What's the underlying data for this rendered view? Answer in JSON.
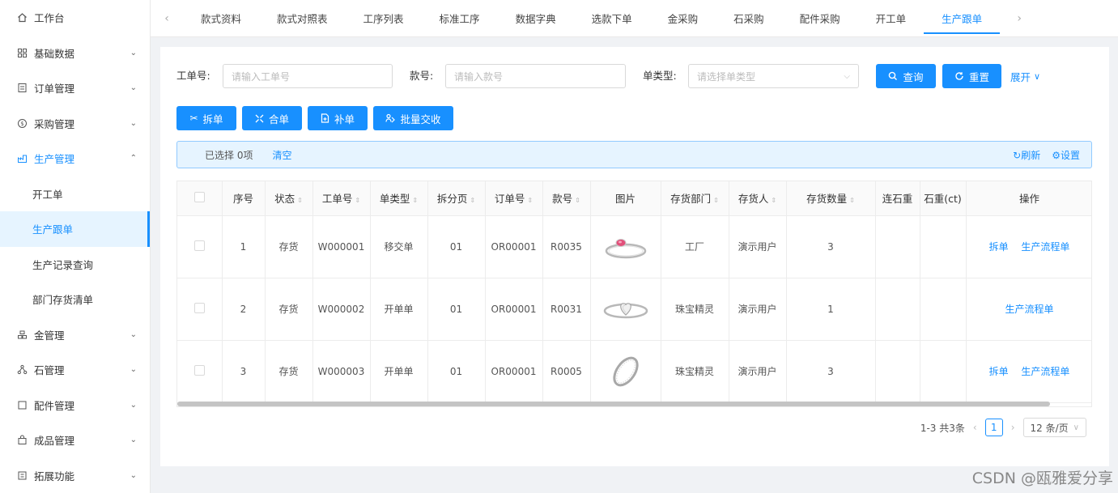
{
  "sidebar": {
    "top_item": {
      "label": "工作台",
      "icon": "home-icon"
    },
    "items": [
      {
        "label": "基础数据",
        "icon": "grid-icon",
        "arrow": "down"
      },
      {
        "label": "订单管理",
        "icon": "order-icon",
        "arrow": "down"
      },
      {
        "label": "采购管理",
        "icon": "dollar-icon",
        "arrow": "down"
      },
      {
        "label": "生产管理",
        "icon": "factory-icon",
        "arrow": "up"
      }
    ],
    "production_sub": [
      {
        "label": "开工单"
      },
      {
        "label": "生产跟单"
      },
      {
        "label": "生产记录查询"
      },
      {
        "label": "部门存货清单"
      }
    ],
    "more_items": [
      {
        "label": "金管理",
        "icon": "gold-icon",
        "arrow": "down"
      },
      {
        "label": "石管理",
        "icon": "stone-icon",
        "arrow": "down"
      },
      {
        "label": "配件管理",
        "icon": "box-icon",
        "arrow": "down"
      },
      {
        "label": "成品管理",
        "icon": "bag-icon",
        "arrow": "down"
      },
      {
        "label": "拓展功能",
        "icon": "extend-icon",
        "arrow": "down"
      }
    ]
  },
  "tabs": [
    "款式资料",
    "款式对照表",
    "工序列表",
    "标准工序",
    "数据字典",
    "选款下单",
    "金采购",
    "石采购",
    "配件采购",
    "开工单",
    "生产跟单"
  ],
  "filters": {
    "work_order_label": "工单号:",
    "work_order_placeholder": "请输入工单号",
    "style_label": "款号:",
    "style_placeholder": "请输入款号",
    "type_label": "单类型:",
    "type_placeholder": "请选择单类型",
    "query": "查询",
    "reset": "重置",
    "expand": "展开"
  },
  "actions": {
    "split": "拆单",
    "merge": "合单",
    "supplement": "补单",
    "batch_handover": "批量交收"
  },
  "alert": {
    "selected_text": "已选择 0项",
    "clear": "清空",
    "refresh": "刷新",
    "settings": "设置"
  },
  "table": {
    "headers": {
      "seq": "序号",
      "status": "状态",
      "work_order": "工单号",
      "order_type": "单类型",
      "split_page": "拆分页",
      "order_no": "订单号",
      "style_no": "款号",
      "image": "图片",
      "dept": "存货部门",
      "holder": "存货人",
      "qty": "存货数量",
      "stone_count": "连石重",
      "stone_weight": "石重(ct)",
      "ops": "操作"
    },
    "rows": [
      {
        "seq": "1",
        "status": "存货",
        "work_order": "W000001",
        "order_type": "移交单",
        "split_page": "01",
        "order_no": "OR00001",
        "style_no": "R0035",
        "dept": "工厂",
        "holder": "演示用户",
        "qty": "3",
        "ops": [
          "拆单",
          "生产流程单"
        ]
      },
      {
        "seq": "2",
        "status": "存货",
        "work_order": "W000002",
        "order_type": "开单单",
        "split_page": "01",
        "order_no": "OR00001",
        "style_no": "R0031",
        "dept": "珠宝精灵",
        "holder": "演示用户",
        "qty": "1",
        "ops": [
          "生产流程单"
        ]
      },
      {
        "seq": "3",
        "status": "存货",
        "work_order": "W000003",
        "order_type": "开单单",
        "split_page": "01",
        "order_no": "OR00001",
        "style_no": "R0005",
        "dept": "珠宝精灵",
        "holder": "演示用户",
        "qty": "3",
        "ops": [
          "拆单",
          "生产流程单"
        ]
      }
    ]
  },
  "pagination": {
    "summary": "1-3 共3条",
    "current": "1",
    "page_size": "12 条/页"
  },
  "watermark": "CSDN @瓯雅爱分享",
  "colors": {
    "primary": "#1890ff",
    "alert_bg": "#e6f4ff"
  }
}
